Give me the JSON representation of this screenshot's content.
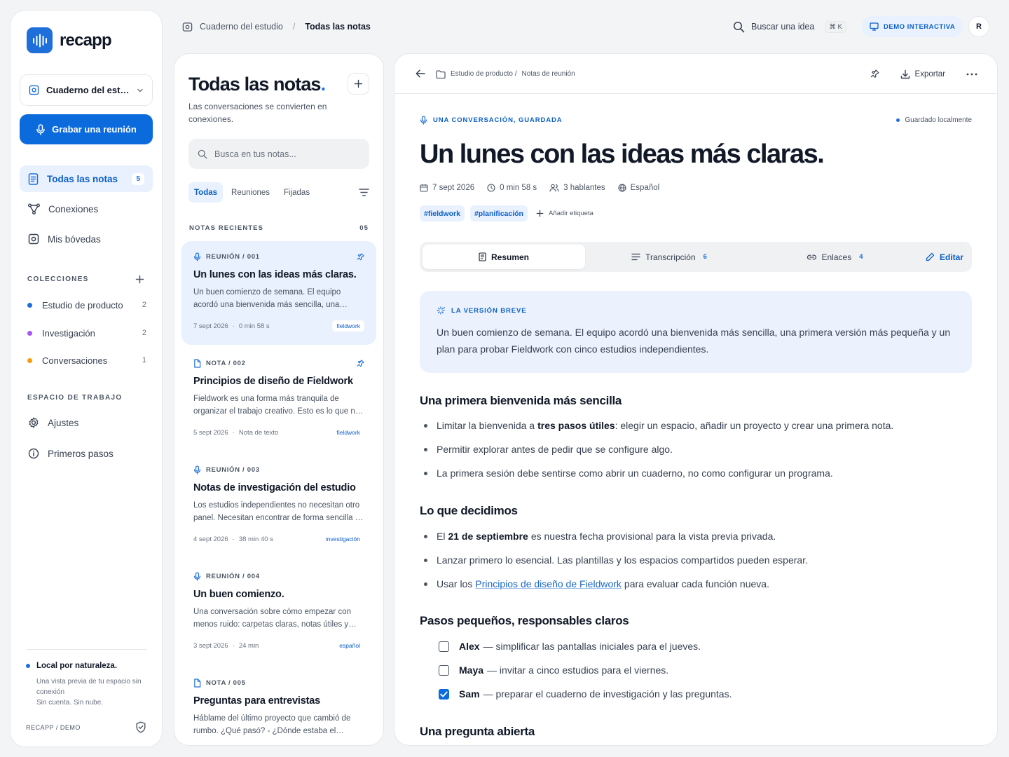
{
  "app": {
    "name": "recapp"
  },
  "sidebar": {
    "notebook": "Cuaderno del estudio",
    "record_label": "Grabar una reunión",
    "nav": [
      {
        "label": "Todas las notas",
        "badge": "5",
        "icon": "notes-icon"
      },
      {
        "label": "Conexiones",
        "icon": "connections-icon"
      },
      {
        "label": "Mis bóvedas",
        "icon": "vault-icon"
      }
    ],
    "collections_title": "COLECCIONES",
    "collections": [
      {
        "label": "Estudio de producto",
        "count": "2",
        "color": "#1e6fd9"
      },
      {
        "label": "Investigación",
        "count": "2",
        "color": "#a855f7"
      },
      {
        "label": "Conversaciones",
        "count": "1",
        "color": "#f59e0b"
      }
    ],
    "workspace_title": "ESPACIO DE TRABAJO",
    "workspace": [
      {
        "label": "Ajustes",
        "icon": "gear-icon"
      },
      {
        "label": "Primeros pasos",
        "icon": "info-icon"
      }
    ],
    "local": {
      "title": "Local por naturaleza.",
      "lines": [
        "Una vista previa de tu espacio sin conexión",
        "Sin cuenta. Sin nube."
      ]
    },
    "footer": "RECAPP / DEMO"
  },
  "topbar": {
    "crumb_root": "Cuaderno del estudio",
    "crumb_current": "Todas las notas",
    "search_label": "Buscar una idea",
    "shortcut": "⌘ K",
    "demo_label": "DEMO INTERACTIVA",
    "avatar": "R"
  },
  "list": {
    "title": "Todas las notas",
    "title_dot": ".",
    "subtitle": "Las conversaciones se convierten en conexiones.",
    "search_placeholder": "Busca en tus notas...",
    "tabs": [
      "Todas",
      "Reuniones",
      "Fijadas"
    ],
    "recent_label": "NOTAS RECIENTES",
    "recent_count": "05",
    "notes": [
      {
        "kind": "REUNIÓN / 001",
        "icon": "mic-icon",
        "pinned": true,
        "title": "Un lunes con las ideas más claras.",
        "excerpt": "Un buen comienzo de semana. El equipo acordó una bienvenida más sencilla, una primera versión más pequeña y un plan.",
        "date": "7 sept 2026",
        "info": "0 min 58 s",
        "tag": "fieldwork"
      },
      {
        "kind": "NOTA / 002",
        "icon": "file-icon",
        "pinned": true,
        "title": "Principios de diseño de Fieldwork",
        "excerpt": "Fieldwork es una forma más tranquila de organizar el trabajo creativo. Esto es lo que nos guía.",
        "date": "5 sept 2026",
        "info": "Nota de texto",
        "tag": "fieldwork"
      },
      {
        "kind": "REUNIÓN / 003",
        "icon": "mic-icon",
        "pinned": false,
        "title": "Notas de investigación del estudio",
        "excerpt": "Los estudios independientes no necesitan otro panel. Necesitan encontrar de forma sencilla lo que ya saben.",
        "date": "4 sept 2026",
        "info": "38 min 40 s",
        "tag": "investigación"
      },
      {
        "kind": "REUNIÓN / 004",
        "icon": "mic-icon",
        "pinned": false,
        "title": "Un buen comienzo.",
        "excerpt": "Una conversación sobre cómo empezar con menos ruido: carpetas claras, notas útiles y menos pasos.",
        "date": "3 sept 2026",
        "info": "24 min",
        "tag": "español"
      },
      {
        "kind": "NOTA / 005",
        "icon": "file-icon",
        "pinned": false,
        "title": "Preguntas para entrevistas",
        "excerpt": "Háblame del último proyecto que cambió de rumbo. ¿Qué pasó? - ¿Dónde estaba el equipo?",
        "date": "",
        "info": "",
        "tag": ""
      }
    ]
  },
  "detail": {
    "crumb": [
      "Estudio de producto /",
      "Notas de reunión"
    ],
    "export_label": "Exportar",
    "eyebrow": "UNA CONVERSACIÓN, GUARDADA",
    "saved": "Guardado localmente",
    "title": "Un lunes con las ideas más claras.",
    "meta": {
      "date": "7 sept 2026",
      "duration": "0 min 58 s",
      "speakers": "3 hablantes",
      "language": "Español"
    },
    "tags": [
      "#fieldwork",
      "#planificación"
    ],
    "add_tag": "Añadir etiqueta",
    "tabs": {
      "summary": "Resumen",
      "transcript": "Transcripción",
      "transcript_count": "6",
      "links": "Enlaces",
      "links_count": "4",
      "edit": "Editar"
    },
    "brief": {
      "label": "LA VERSIÓN BREVE",
      "text": "Un buen comienzo de semana. El equipo acordó una bienvenida más sencilla, una primera versión más pequeña y un plan para probar Fieldwork con cinco estudios independientes."
    },
    "s1": {
      "title": "Una primera bienvenida más sencilla",
      "b1_pre": "Limitar la bienvenida a",
      "b1_bold": "tres pasos útiles",
      "b1_post": ": elegir un espacio, añadir un proyecto y crear una primera nota.",
      "b2": "Permitir explorar antes de pedir que se configure algo.",
      "b3": "La primera sesión debe sentirse como abrir un cuaderno, no como configurar un programa."
    },
    "s2": {
      "title": "Lo que decidimos",
      "b1_pre": "El",
      "b1_bold": "21 de septiembre",
      "b1_post": "es nuestra fecha provisional para la vista previa privada.",
      "b2": "Lanzar primero lo esencial. Las plantillas y los espacios compartidos pueden esperar.",
      "b3_pre": "Usar los",
      "b3_link": "Principios de diseño de Fieldwork",
      "b3_post": "para evaluar cada función nueva."
    },
    "s3": {
      "title": "Pasos pequeños, responsables claros",
      "tasks": [
        {
          "who": "Alex",
          "text": "— simplificar las pantallas iniciales para el jueves.",
          "done": false
        },
        {
          "who": "Maya",
          "text": "— invitar a cinco estudios para el viernes.",
          "done": false
        },
        {
          "who": "Sam",
          "text": "— preparar el cuaderno de investigación y las preguntas.",
          "done": true
        }
      ]
    },
    "s4": {
      "title": "Una pregunta abierta"
    }
  }
}
